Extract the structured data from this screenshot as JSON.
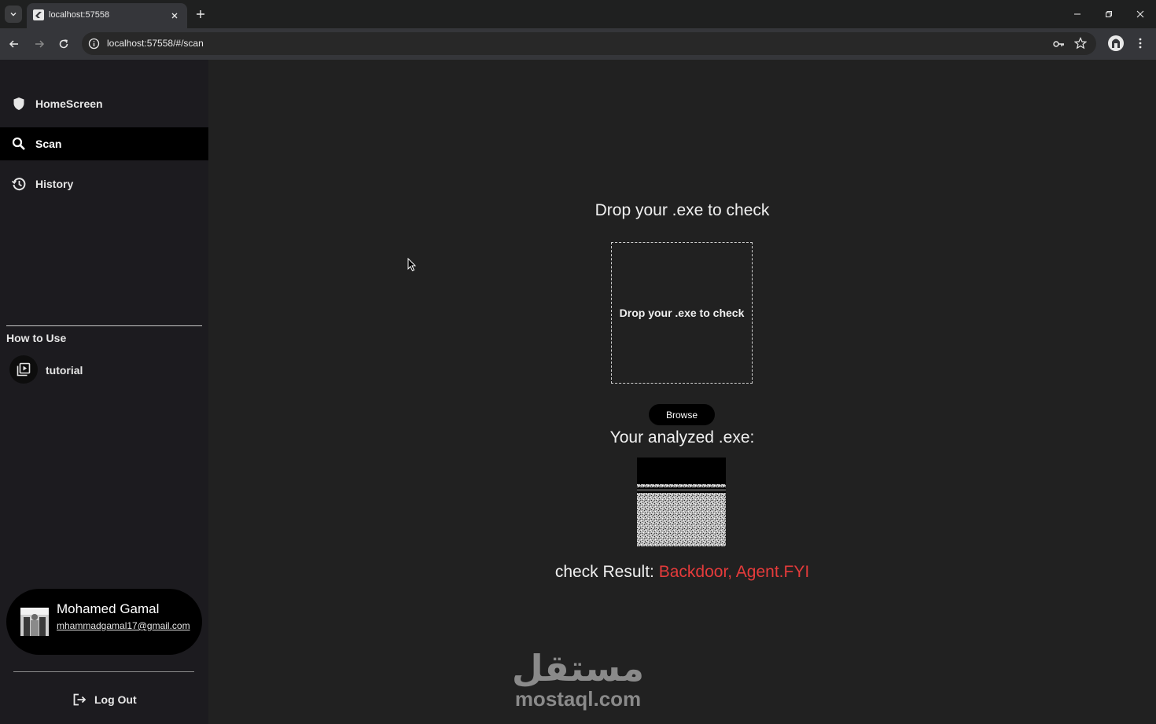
{
  "browser": {
    "tab_title": "localhost:57558",
    "url": "localhost:57558/#/scan"
  },
  "sidebar": {
    "items": [
      {
        "label": "HomeScreen",
        "icon": "shield-icon",
        "active": false
      },
      {
        "label": "Scan",
        "icon": "search-icon",
        "active": true
      },
      {
        "label": "History",
        "icon": "history-icon",
        "active": false
      }
    ],
    "section_title": "How to Use",
    "tutorial_label": "tutorial",
    "user": {
      "name": "Mohamed Gamal",
      "email": "mhammadgamal17@gmail.com"
    },
    "logout_label": "Log Out"
  },
  "main": {
    "drop_title": "Drop your .exe to check",
    "drop_zone_text": "Drop your .exe to check",
    "browse_label": "Browse",
    "analyzed_title": "Your analyzed .exe:",
    "result_label": "check Result:",
    "result_value": "Backdoor, Agent.FYI"
  },
  "watermark": {
    "text": "mostaql.com",
    "glyph": "مستقل"
  },
  "colors": {
    "page_bg": "#212121",
    "sidebar_bg": "#1c1b1f",
    "active_item_bg": "#000000",
    "result_value": "#e53b3b"
  }
}
